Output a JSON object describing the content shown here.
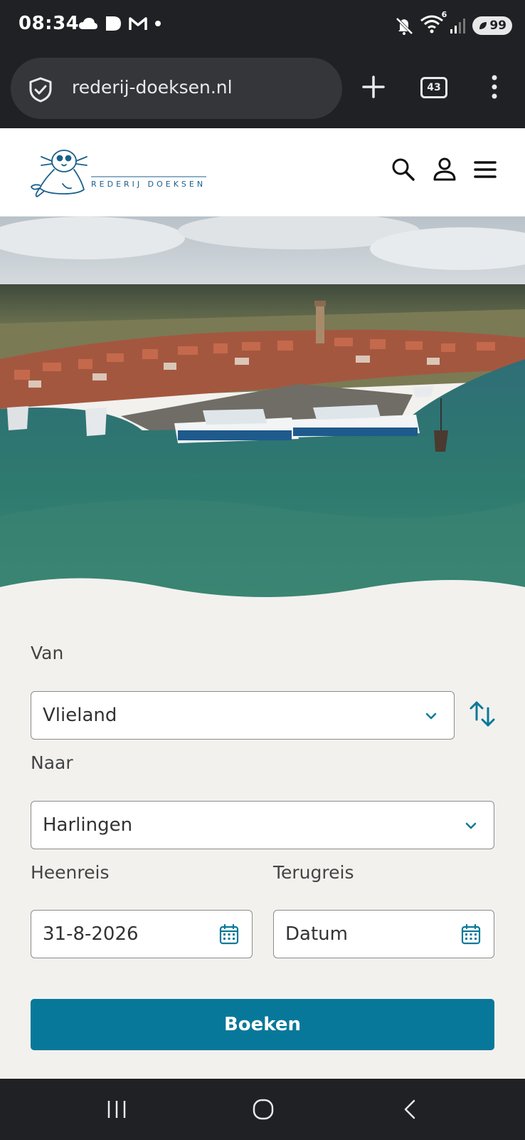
{
  "status_bar": {
    "time": "08:34",
    "left_icons": [
      "cloud-icon",
      "media-icon",
      "gmail-icon",
      "dot-icon"
    ],
    "right_icons": [
      "mute-icon",
      "wifi-icon",
      "signal-icon"
    ],
    "wifi_label": "6",
    "battery": "99"
  },
  "browser": {
    "url": "rederij-doeksen.nl",
    "tab_count": "43"
  },
  "site": {
    "logo_text": "REDERIJ DOEKSEN",
    "header_icons": [
      "search-icon",
      "user-icon",
      "hamburger-menu-icon"
    ]
  },
  "form": {
    "from_label": "Van",
    "from_value": "Vlieland",
    "to_label": "Naar",
    "to_value": "Harlingen",
    "outbound_label": "Heenreis",
    "outbound_value": "31-8-2026",
    "return_label": "Terugreis",
    "return_placeholder": "Datum",
    "submit_label": "Boeken"
  },
  "colors": {
    "accent": "#08789a",
    "dark_bar": "#202124",
    "page_bg": "#f2f1ee"
  }
}
